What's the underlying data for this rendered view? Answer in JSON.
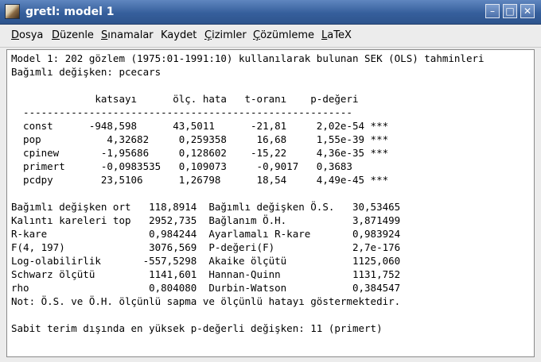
{
  "window": {
    "title": "gretl: model 1",
    "buttons": {
      "minimize": "–",
      "maximize": "□",
      "close": "✕"
    }
  },
  "menubar": {
    "items": [
      {
        "mnemonic": "D",
        "rest": "osya"
      },
      {
        "mnemonic": "D",
        "rest": "üzenle"
      },
      {
        "mnemonic": "S",
        "rest": "ınamalar"
      },
      {
        "mnemonic": "K",
        "rest": "aydet",
        "display": "Kaydet"
      },
      {
        "mnemonic": "Ç",
        "rest": "izimler"
      },
      {
        "mnemonic": "Ç",
        "rest": "özümleme"
      },
      {
        "mnemonic": "L",
        "rest": "aTeX"
      }
    ]
  },
  "output": {
    "header": "Model 1: 202 gözlem (1975:01-1991:10) kullanılarak bulunan SEK (OLS) tahminleri",
    "dependent": "Bağımlı değişken: pcecars",
    "table_header": "              katsayı      ölç. hata   t-oranı    p-değeri",
    "separator": "  -------------------------------------------------------",
    "coef_rows": [
      "  const      -948,598      43,5011      -21,81     2,02e-54 ***",
      "  pop           4,32682     0,259358     16,68     1,55e-39 ***",
      "  cpinew       -1,95686     0,128602    -15,22     4,36e-35 ***",
      "  primert      -0,0983535   0,109073     -0,9017   0,3683",
      "  pcdpy        23,5106      1,26798      18,54     4,49e-45 ***"
    ],
    "stats_rows": [
      "Bağımlı değişken ort   118,8914  Bağımlı değişken Ö.S.   30,53465",
      "Kalıntı kareleri top   2952,735  Bağlanım Ö.H.           3,871499",
      "R-kare                 0,984244  Ayarlamalı R-kare       0,983924",
      "F(4, 197)              3076,569  P-değeri(F)             2,7e-176",
      "Log-olabilirlik       -557,5298  Akaike ölçütü           1125,060",
      "Schwarz ölçütü         1141,601  Hannan-Quinn            1131,752",
      "rho                    0,804080  Durbin-Watson           0,384547"
    ],
    "note": "Not: Ö.S. ve Ö.H. ölçünlü sapma ve ölçünlü hatayı göstermektedir.",
    "footer": "Sabit terim dışında en yüksek p-değerli değişken: 11 (primert)"
  }
}
